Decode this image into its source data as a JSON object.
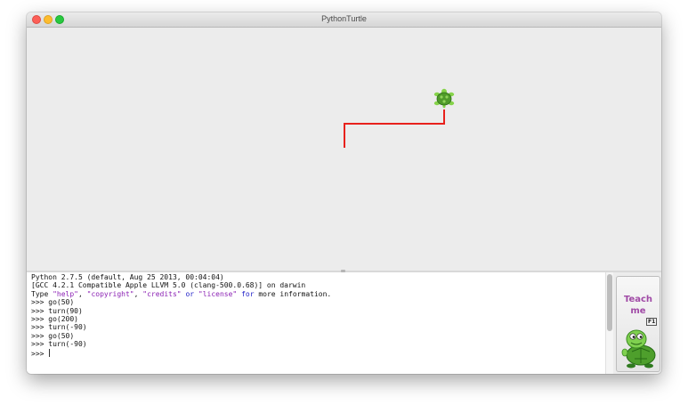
{
  "window": {
    "title": "PythonTurtle"
  },
  "shell": {
    "banner_line1": "Python 2.7.5 (default, Aug 25 2013, 00:04:04)",
    "banner_line2": "[GCC 4.2.1 Compatible Apple LLVM 5.0 (clang-500.0.68)] on darwin",
    "banner_line3": {
      "prefix": "Type ",
      "help": "\"help\"",
      "sep1": ", ",
      "copyright": "\"copyright\"",
      "sep2": ", ",
      "credits": "\"credits\"",
      "or": " or ",
      "license": "\"license\"",
      "for_word": " for",
      "suffix": " more information."
    },
    "prompt": ">>> ",
    "commands": [
      "go(50)",
      "turn(90)",
      "go(200)",
      "turn(-90)",
      "go(50)",
      "turn(-90)"
    ]
  },
  "teach_button": {
    "line1": "Teach",
    "line2": "me",
    "shortcut": "F1"
  },
  "colors": {
    "path": "#e8211c",
    "turtle_shell": "#4f9a2a",
    "turtle_skin": "#86d34a"
  }
}
